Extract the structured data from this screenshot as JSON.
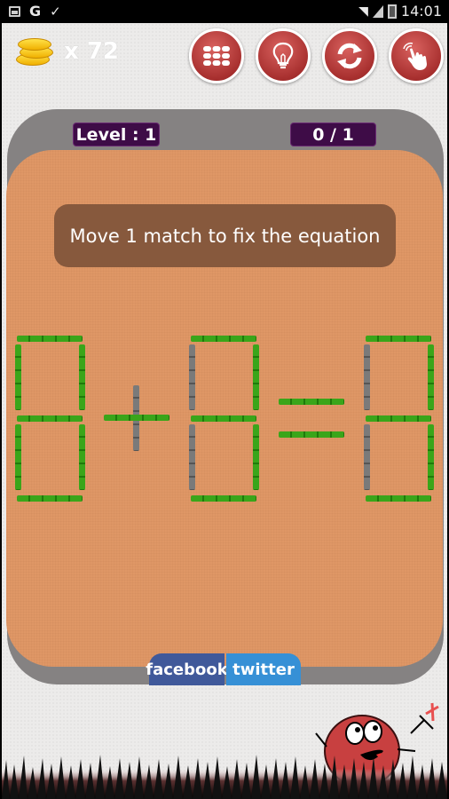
{
  "status_bar": {
    "left_icons": [
      "image-icon",
      "google-icon",
      "checkbox-icon"
    ],
    "google_glyph": "G",
    "right_icons": [
      "wifi-icon",
      "signal-icon",
      "battery-charging-icon"
    ],
    "time": "14:01"
  },
  "header": {
    "coins_icon": "coin-stack-icon",
    "coins_label": "x 72",
    "coins": 72,
    "toolbar": [
      {
        "name": "levels-button",
        "icon": "grid-icon"
      },
      {
        "name": "hint-button",
        "icon": "lightbulb-icon"
      },
      {
        "name": "restart-button",
        "icon": "refresh-icon"
      },
      {
        "name": "tap-button",
        "icon": "hand-tap-icon"
      }
    ]
  },
  "board": {
    "level_label": "Level : 1",
    "score_label": "0 / 1",
    "instruction": "Move 1 match to fix the equation",
    "equation": {
      "digits": [
        "8",
        "8",
        "8"
      ],
      "operator": "+",
      "equals": "=",
      "description": "8 + 8 = 8 with grey (movable) sticks highlighted"
    }
  },
  "social": {
    "facebook_label": "facebook",
    "twitter_label": "twitter"
  },
  "colors": {
    "board_orange": "#df9766",
    "board_frame": "#858282",
    "pill_purple": "#3e0c47",
    "instruction_brown": "#87593d",
    "button_red": "#a8302f",
    "match_green": "#3aa51a",
    "match_grey": "#7a7a7a",
    "facebook": "#40599a",
    "twitter": "#3690d6"
  }
}
